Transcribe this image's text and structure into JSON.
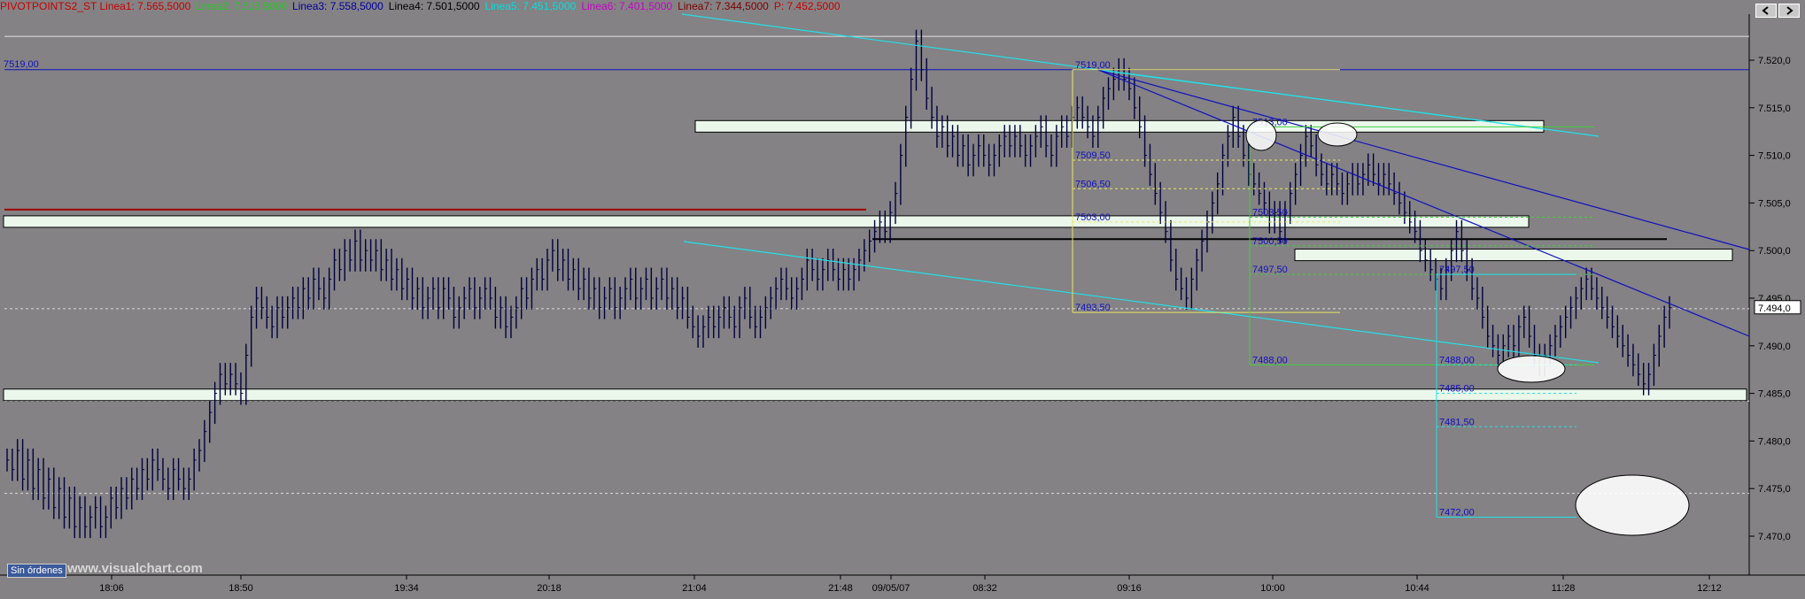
{
  "header": {
    "items": [
      {
        "label": "PIVOTPOINTS2_ST Linea1: 7.565,5000",
        "color": "#c80000"
      },
      {
        "label": "Linea2: 7.515,5000",
        "color": "#22cc22"
      },
      {
        "label": "Linea3: 7.558,5000",
        "color": "#0000a0"
      },
      {
        "label": "Linea4: 7.501,5000",
        "color": "#000000"
      },
      {
        "label": "Linea5: 7.451,5000",
        "color": "#00e0e0"
      },
      {
        "label": "Linea6: 7.401,5000",
        "color": "#cc00cc"
      },
      {
        "label": "Linea7: 7.344,5000",
        "color": "#800000"
      },
      {
        "label": "P: 7.452,5000",
        "color": "#c80000"
      }
    ]
  },
  "sin_ordenes": "Sin órdenes",
  "watermark": "www.visualchart.com",
  "last_price_label": "7.494,0",
  "colors": {
    "background": "#848284",
    "bars": "#000040",
    "blue_line": "#1010c0",
    "cyan_line": "#20e0e8",
    "yellow_line": "#e8e860",
    "green_line": "#40d040",
    "red_line": "#a00000",
    "band_fill": "#eaf7ea"
  },
  "chart_data": {
    "type": "bar",
    "y_axis": {
      "ticks": [
        "7.520,0",
        "7.515,0",
        "7.510,0",
        "7.505,0",
        "7.500,0",
        "7.495,0",
        "7.490,0",
        "7.485,0",
        "7.480,0",
        "7.475,0",
        "7.470,0"
      ],
      "range": [
        7466,
        7531
      ]
    },
    "x_axis": {
      "ticks": [
        "18:06",
        "18:50",
        "19:34",
        "20:18",
        "21:04",
        "21:48",
        "09/05/07",
        "08:32",
        "09:16",
        "10:00",
        "10:44",
        "11:28",
        "12:12"
      ]
    },
    "key_price": {
      "label": "7519,00",
      "value": 7519.0
    },
    "fib_levels_1": [
      {
        "label": "7519,00",
        "value": 7519.0
      },
      {
        "label": "7509,50",
        "value": 7509.5
      },
      {
        "label": "7506,50",
        "value": 7506.5
      },
      {
        "label": "7503,00",
        "value": 7503.0
      },
      {
        "label": "7493,50",
        "value": 7493.5
      }
    ],
    "fib_levels_2": [
      {
        "label": "7513,00",
        "value": 7513.0
      },
      {
        "label": "7503,50",
        "value": 7503.5
      },
      {
        "label": "7500,50",
        "value": 7500.5
      },
      {
        "label": "7497,50",
        "value": 7497.5
      },
      {
        "label": "7488,00",
        "value": 7488.0
      }
    ],
    "fib_levels_3": [
      {
        "label": "7497,50",
        "value": 7497.5
      },
      {
        "label": "7488,00",
        "value": 7488.0
      },
      {
        "label": "7485,00",
        "value": 7485.0
      },
      {
        "label": "7481,50",
        "value": 7481.5
      },
      {
        "label": "7472,00",
        "value": 7472.0
      }
    ],
    "bands": [
      {
        "name": "band-upper",
        "value": 7513.0
      },
      {
        "name": "band-mid",
        "value": 7503.0
      },
      {
        "name": "band-right",
        "value": 7499.5
      },
      {
        "name": "band-lower",
        "value": 7484.8
      }
    ],
    "horizontal_lines": [
      {
        "value": 7522.5,
        "color": "#e0e0e0"
      },
      {
        "value": 7519.0,
        "color": "#1010c0"
      },
      {
        "value": 7504.3,
        "color": "#a00000"
      },
      {
        "value": 7501.2,
        "color": "#000000"
      },
      {
        "value": 7493.9,
        "color": "#dcdcdc",
        "dashed": true
      },
      {
        "value": 7484.2,
        "color": "#dcdcdc",
        "dashed": true
      },
      {
        "value": 7474.5,
        "color": "#dcdcdc",
        "dashed": true
      }
    ],
    "series_close": [
      7478,
      7477,
      7479,
      7476,
      7478,
      7475,
      7477,
      7474,
      7476,
      7473,
      7475,
      7472,
      7474,
      7471,
      7473,
      7471,
      7472,
      7473,
      7471,
      7472,
      7474,
      7473,
      7475,
      7474,
      7476,
      7475,
      7477,
      7476,
      7478,
      7477,
      7476,
      7475,
      7477,
      7476,
      7475,
      7476,
      7478,
      7479,
      7481,
      7483,
      7485,
      7487,
      7486,
      7487,
      7486,
      7485,
      7489,
      7493,
      7495,
      7494,
      7493,
      7492,
      7494,
      7493,
      7494,
      7495,
      7494,
      7496,
      7495,
      7497,
      7496,
      7495,
      7497,
      7499,
      7498,
      7500,
      7499,
      7501,
      7499,
      7500,
      7499,
      7500,
      7498,
      7499,
      7497,
      7498,
      7496,
      7497,
      7495,
      7496,
      7494,
      7495,
      7496,
      7494,
      7496,
      7495,
      7493,
      7494,
      7495,
      7496,
      7494,
      7495,
      7496,
      7495,
      7493,
      7494,
      7492,
      7493,
      7494,
      7496,
      7495,
      7497,
      7498,
      7497,
      7499,
      7500,
      7498,
      7499,
      7497,
      7498,
      7496,
      7497,
      7495,
      7496,
      7494,
      7495,
      7496,
      7494,
      7495,
      7496,
      7497,
      7495,
      7496,
      7497,
      7495,
      7496,
      7497,
      7495,
      7496,
      7494,
      7495,
      7493,
      7492,
      7491,
      7492,
      7493,
      7492,
      7493,
      7494,
      7493,
      7492,
      7494,
      7495,
      7493,
      7492,
      7493,
      7494,
      7495,
      7496,
      7497,
      7496,
      7495,
      7496,
      7497,
      7499,
      7498,
      7497,
      7498,
      7499,
      7498,
      7497,
      7498,
      7497,
      7498,
      7499,
      7500,
      7501,
      7502,
      7503,
      7502,
      7504,
      7506,
      7510,
      7514,
      7518,
      7522,
      7519,
      7516,
      7514,
      7512,
      7513,
      7511,
      7512,
      7510,
      7511,
      7509,
      7510,
      7511,
      7510,
      7509,
      7510,
      7511,
      7512,
      7511,
      7512,
      7511,
      7510,
      7511,
      7512,
      7513,
      7511,
      7510,
      7512,
      7513,
      7512,
      7514,
      7515,
      7514,
      7513,
      7512,
      7514,
      7516,
      7517,
      7518,
      7519,
      7518,
      7517,
      7515,
      7513,
      7510,
      7508,
      7506,
      7504,
      7502,
      7499,
      7497,
      7496,
      7495,
      7497,
      7499,
      7501,
      7503,
      7505,
      7507,
      7510,
      7512,
      7514,
      7512,
      7510,
      7508,
      7507,
      7506,
      7505,
      7503,
      7504,
      7502,
      7504,
      7506,
      7508,
      7510,
      7512,
      7511,
      7509,
      7508,
      7507,
      7508,
      7507,
      7506,
      7507,
      7508,
      7507,
      7508,
      7509,
      7508,
      7507,
      7508,
      7507,
      7506,
      7505,
      7504,
      7503,
      7502,
      7500,
      7499,
      7498,
      7497,
      7496,
      7498,
      7500,
      7502,
      7500,
      7498,
      7496,
      7495,
      7493,
      7491,
      7490,
      7489,
      7490,
      7491,
      7490,
      7492,
      7493,
      7491,
      7489,
      7488,
      7489,
      7490,
      7491,
      7492,
      7493,
      7494,
      7495,
      7496,
      7497,
      7496,
      7495,
      7494,
      7493,
      7492,
      7491,
      7490,
      7489,
      7488,
      7487,
      7486,
      7487,
      7489,
      7491,
      7493,
      7494
    ]
  }
}
